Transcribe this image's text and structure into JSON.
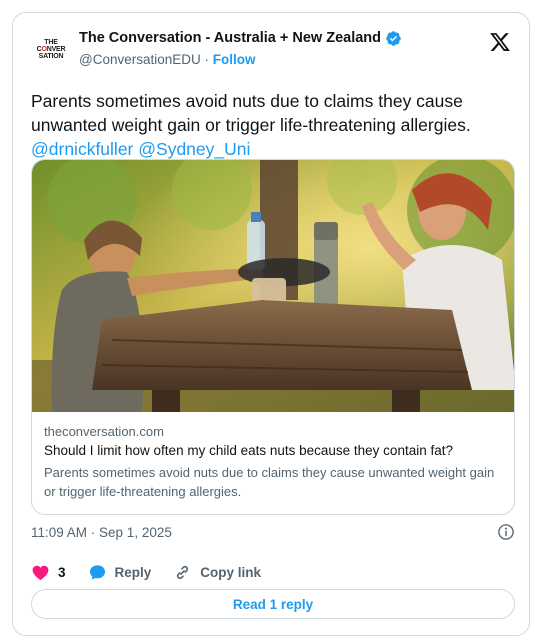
{
  "author": {
    "display_name": "The Conversation - Australia + New Zealand",
    "handle": "@ConversationEDU",
    "separator": " · ",
    "follow_label": "Follow",
    "avatar_lines": [
      "THE",
      "CONVER",
      "SATION"
    ]
  },
  "tweet": {
    "text": "Parents sometimes avoid nuts due to claims they cause unwanted weight gain or trigger life-threatening allergies.",
    "mentions": [
      "@drnickfuller",
      "@Sydney_Uni"
    ]
  },
  "link_card": {
    "domain": "theconversation.com",
    "title": "Should I limit how often my child eats nuts because they contain fat?",
    "description": "Parents sometimes avoid nuts due to claims they cause unwanted weight gain or trigger life-threatening allergies."
  },
  "timestamp": "11:09 AM · Sep 1, 2025",
  "actions": {
    "like_count": "3",
    "reply_label": "Reply",
    "copy_label": "Copy link"
  },
  "read_replies_label": "Read 1 reply",
  "colors": {
    "accent": "#1d9bf0",
    "like": "#f91880",
    "muted": "#536471",
    "border": "#cfd9de"
  },
  "icons": [
    "verified-badge-icon",
    "x-logo-icon",
    "info-icon",
    "heart-icon",
    "reply-bubble-icon",
    "link-icon"
  ]
}
